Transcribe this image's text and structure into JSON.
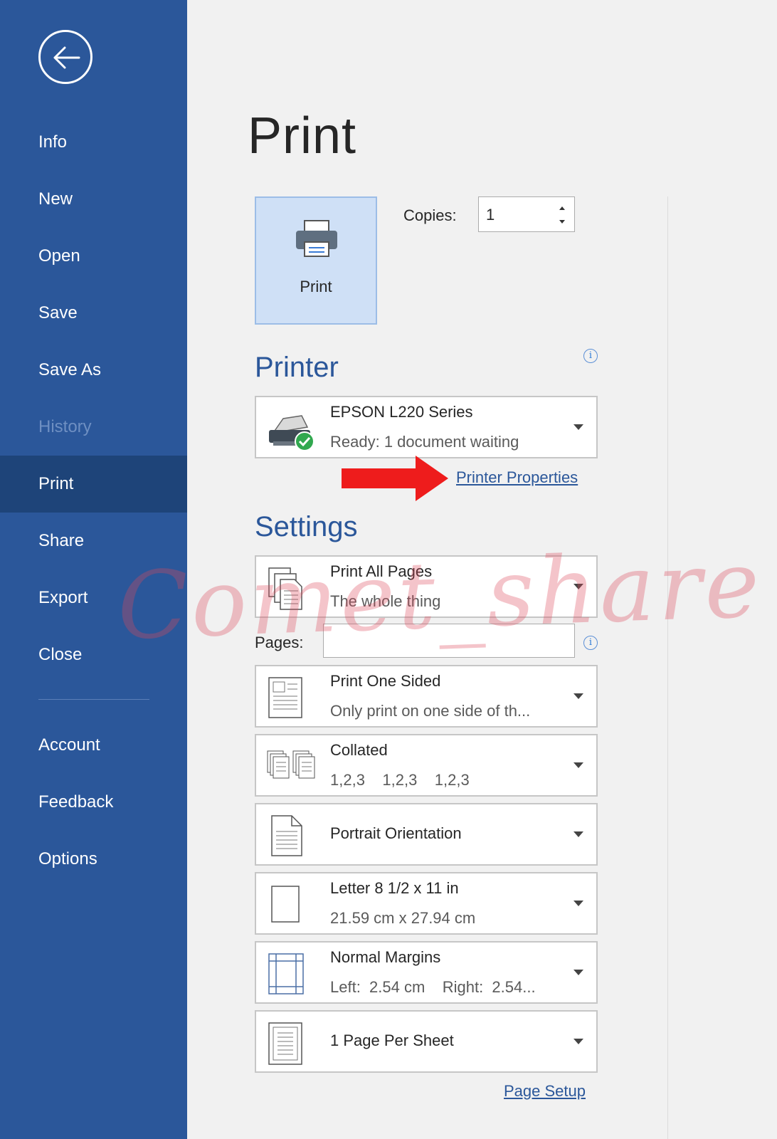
{
  "sidebar": {
    "back_icon": "arrow-left-circle-icon",
    "items": [
      {
        "label": "Info"
      },
      {
        "label": "New"
      },
      {
        "label": "Open"
      },
      {
        "label": "Save"
      },
      {
        "label": "Save As"
      },
      {
        "label": "History",
        "state": "disabled"
      },
      {
        "label": "Print",
        "state": "selected"
      },
      {
        "label": "Share"
      },
      {
        "label": "Export"
      },
      {
        "label": "Close"
      },
      {
        "label": "Account"
      },
      {
        "label": "Feedback"
      },
      {
        "label": "Options"
      }
    ]
  },
  "main": {
    "title": "Print",
    "print_button": {
      "label": "Print",
      "icon": "printer-icon"
    },
    "copies": {
      "label": "Copies:",
      "value": "1"
    },
    "printer": {
      "heading": "Printer",
      "name": "EPSON L220 Series",
      "status": "Ready: 1 document waiting",
      "properties_link": "Printer Properties"
    },
    "settings": {
      "heading": "Settings",
      "pages_label": "Pages:",
      "pages_value": "",
      "options": [
        {
          "title": "Print All Pages",
          "subtitle": "The whole thing",
          "icon": "pages-stack-icon"
        },
        {
          "title": "Print One Sided",
          "subtitle": "Only print on one side of th...",
          "icon": "one-sided-page-icon"
        },
        {
          "title": "Collated",
          "subtitle": "1,2,3    1,2,3    1,2,3",
          "icon": "collated-pages-icon"
        },
        {
          "title": "Portrait Orientation",
          "subtitle": "",
          "icon": "portrait-page-icon"
        },
        {
          "title": "Letter 8 1/2 x 11 in",
          "subtitle": "21.59 cm x 27.94 cm",
          "icon": "paper-size-icon"
        },
        {
          "title": "Normal Margins",
          "subtitle": "Left:  2.54 cm    Right:  2.54...",
          "icon": "margins-icon"
        },
        {
          "title": "1 Page Per Sheet",
          "subtitle": "",
          "icon": "page-per-sheet-icon"
        }
      ],
      "page_setup_link": "Page Setup"
    },
    "watermark": "Comet_share"
  },
  "colors": {
    "sidebar_bg": "#2b579a",
    "sidebar_selected": "#1e4479",
    "accent": "#2b579a",
    "print_button_bg": "#cfe0f6",
    "annotation_arrow": "#ee1c1c"
  }
}
